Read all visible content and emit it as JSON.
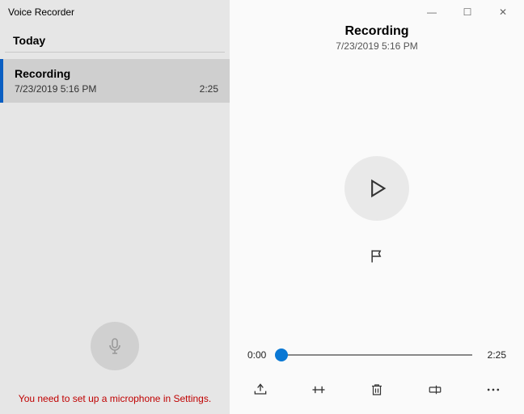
{
  "app_title": "Voice Recorder",
  "sidebar": {
    "section_header": "Today",
    "items": [
      {
        "title": "Recording",
        "date": "7/23/2019 5:16 PM",
        "duration": "2:25"
      }
    ],
    "warning_text": "You need to set up a microphone in Settings."
  },
  "main": {
    "title": "Recording",
    "date": "7/23/2019 5:16 PM",
    "current_time": "0:00",
    "total_time": "2:25"
  },
  "window_controls": {
    "minimize": "—",
    "maximize": "☐",
    "close": "✕"
  }
}
